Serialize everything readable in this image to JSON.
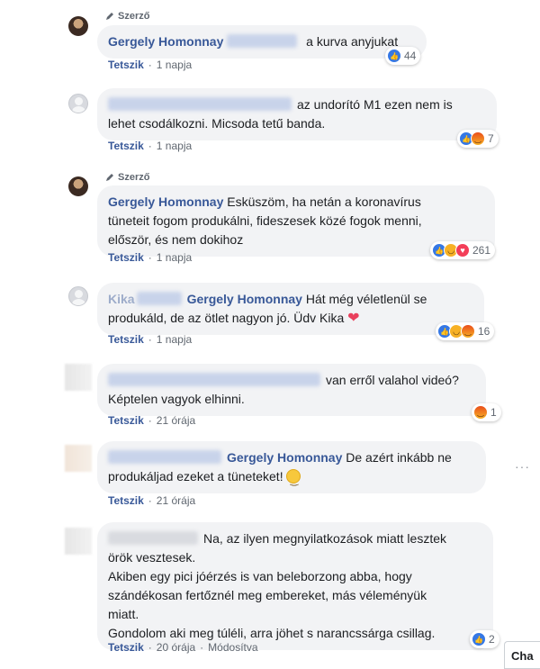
{
  "comments": [
    {
      "badge": "Szerző",
      "author": "Gergely Homonnay",
      "text": "a kurva anyjukat",
      "like": "Tetszik",
      "time": "1 napja",
      "reactions": "44"
    },
    {
      "text_line1": "az undorító M1 ezen nem is",
      "text_line2": "lehet csodálkozni. Micsoda tetű banda.",
      "like": "Tetszik",
      "time": "1 napja",
      "reactions": "7"
    },
    {
      "badge": "Szerző",
      "author": "Gergely Homonnay",
      "text_line1": "Esküszöm, ha netán a koronavírus",
      "text_line2": "tüneteit fogom produkálni, fideszesek közé fogok menni,",
      "text_line3": "először, és nem dokihoz",
      "like": "Tetszik",
      "time": "1 napja",
      "reactions": "261"
    },
    {
      "author_partial": "Kika",
      "mention": "Gergely Homonnay",
      "text_line1": "Hát még véletlenül se",
      "text_line2": "produkáld, de az ötlet nagyon jó. Üdv Kika",
      "like": "Tetszik",
      "time": "1 napja",
      "reactions": "16"
    },
    {
      "text_line1": "van erről valahol videó?",
      "text_line2": "Képtelen vagyok elhinni.",
      "like": "Tetszik",
      "time": "21 órája",
      "reactions": "1"
    },
    {
      "mention": "Gergely Homonnay",
      "text_line1": "De azért inkább ne",
      "text_line2": "produkáljad ezeket a tüneteket!",
      "like": "Tetszik",
      "time": "21 órája",
      "more": "···"
    },
    {
      "text_line1": "Na, az ilyen megnyilatkozások miatt lesztek",
      "text_line2": "örök vesztesek.",
      "text_line3": "Akiben egy pici jóérzés is van beleborzong abba, hogy",
      "text_line4": "szándékosan fertőznél meg embereket, más véleményük",
      "text_line5": "miatt.",
      "text_line6": "Gondolom aki meg túléli, arra jöhet s narancssárga csillag.",
      "like": "Tetszik",
      "time": "20 órája",
      "edited": "Módosítva",
      "reactions": "2"
    }
  ],
  "chat_tab": "Cha",
  "colors": {
    "link": "#385898",
    "bubble": "#f2f3f5",
    "meta": "#606770"
  }
}
